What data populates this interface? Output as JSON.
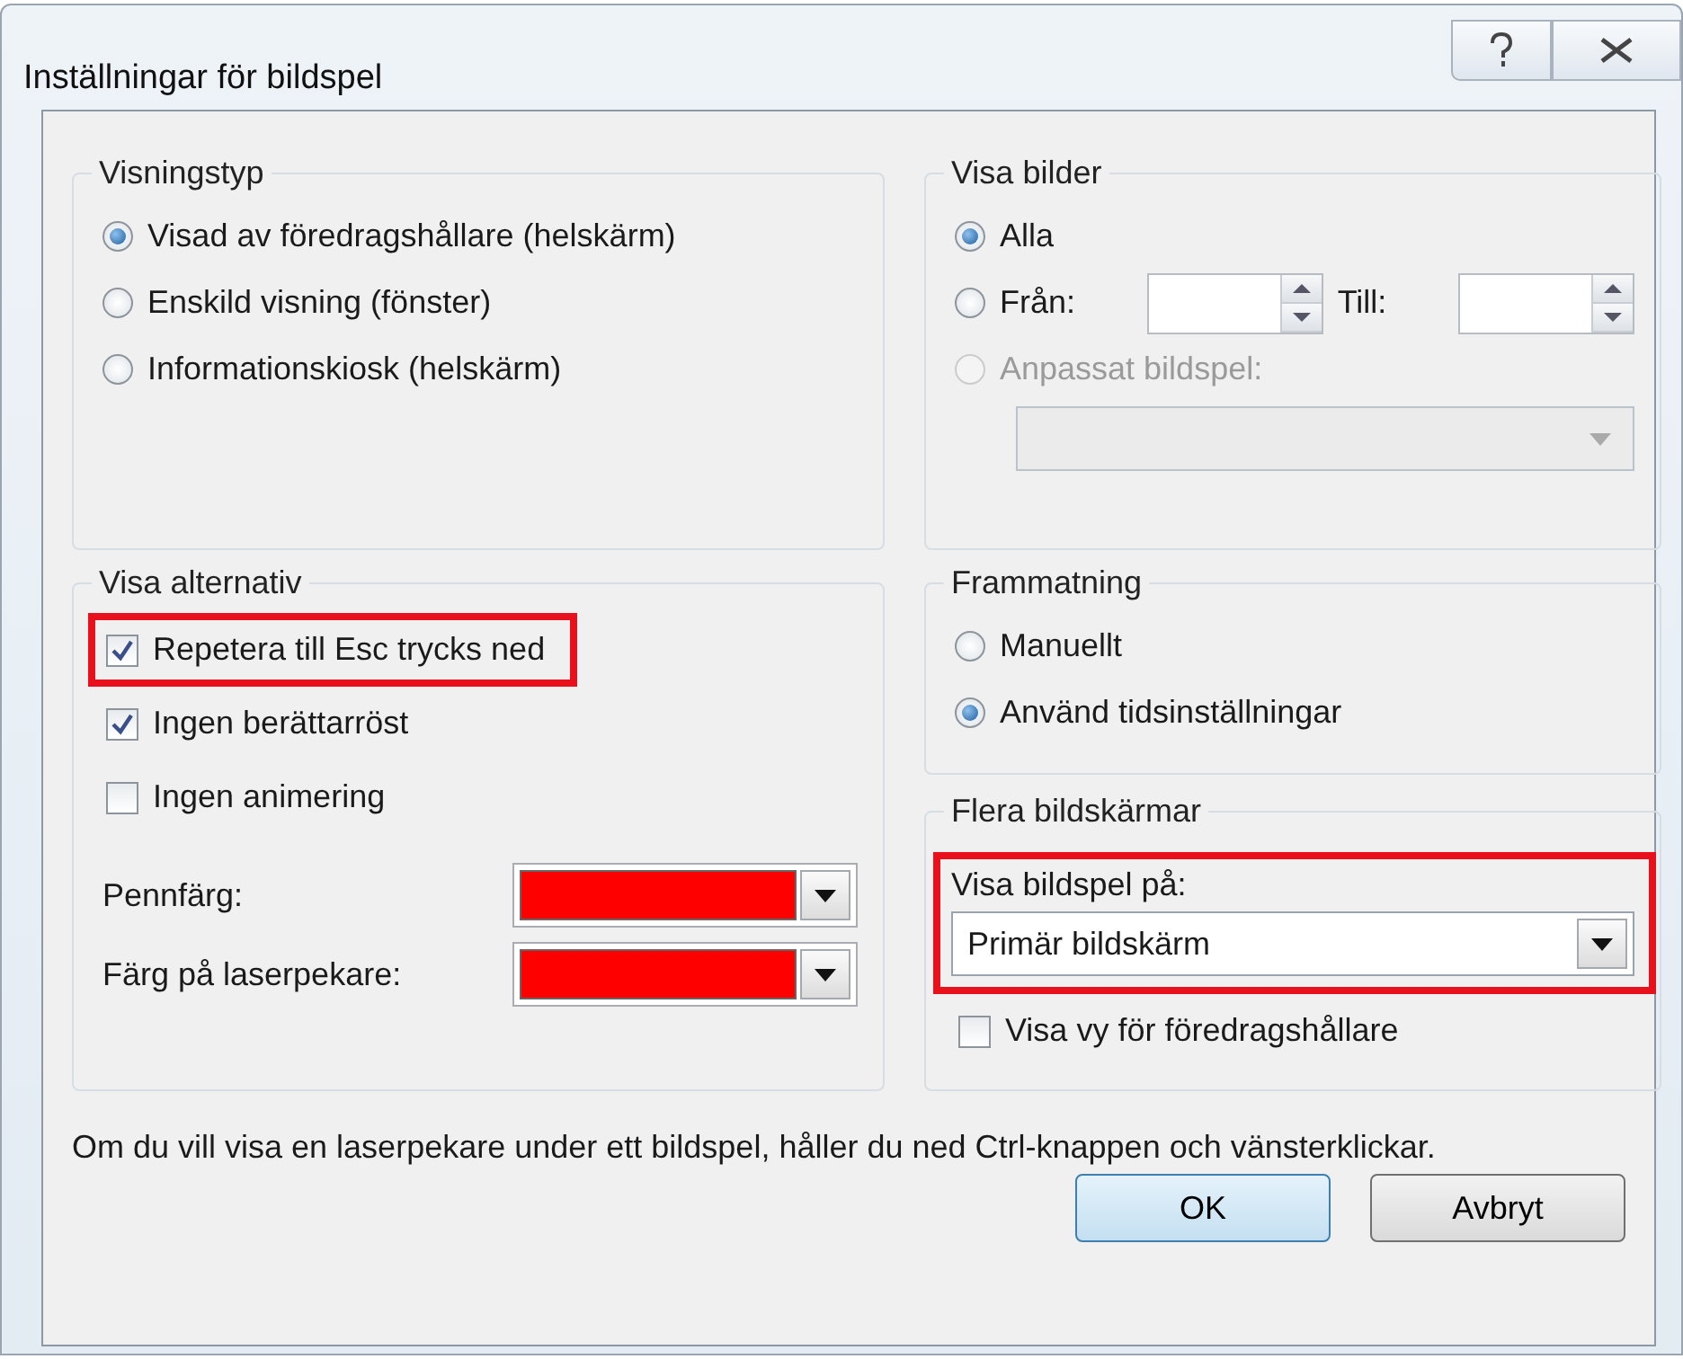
{
  "window": {
    "title": "Inställningar för bildspel"
  },
  "visningstyp": {
    "title": "Visningstyp",
    "options": [
      {
        "label": "Visad av föredragshållare (helskärm)",
        "selected": true
      },
      {
        "label": "Enskild visning (fönster)",
        "selected": false
      },
      {
        "label": "Informationskiosk (helskärm)",
        "selected": false
      }
    ]
  },
  "visa_bilder": {
    "title": "Visa bilder",
    "options": [
      {
        "kind": "plain",
        "label": "Alla",
        "selected": true,
        "disabled": false
      },
      {
        "kind": "range",
        "label": "Från:",
        "to_label": "Till:",
        "selected": false,
        "disabled": false
      },
      {
        "kind": "custom",
        "label": "Anpassat bildspel:",
        "selected": false,
        "disabled": true
      }
    ]
  },
  "visa_alternativ": {
    "title": "Visa alternativ",
    "checkboxes": [
      {
        "label": "Repetera till Esc trycks ned",
        "checked": true,
        "highlighted": true
      },
      {
        "label": "Ingen berättarröst",
        "checked": true,
        "highlighted": false
      },
      {
        "label": "Ingen animering",
        "checked": false,
        "highlighted": false
      }
    ],
    "colors": [
      {
        "label": "Pennfärg:",
        "color": "#ff0000"
      },
      {
        "label": "Färg på laserpekare:",
        "color": "#ff0000"
      }
    ]
  },
  "frammatning": {
    "title": "Frammatning",
    "options": [
      {
        "label": "Manuellt",
        "selected": false
      },
      {
        "label": "Använd tidsinställningar",
        "selected": true
      }
    ]
  },
  "flera_bildskarmar": {
    "title": "Flera bildskärmar",
    "label": "Visa bildspel på:",
    "value": "Primär bildskärm",
    "highlighted": true,
    "checkbox": {
      "label": "Visa vy för föredragshållare",
      "checked": false
    }
  },
  "note": "Om du vill visa en laserpekare under ett bildspel, håller du ned Ctrl-knappen och vänsterklickar.",
  "buttons": [
    {
      "label": "OK",
      "default": true
    },
    {
      "label": "Avbryt",
      "default": false
    }
  ]
}
